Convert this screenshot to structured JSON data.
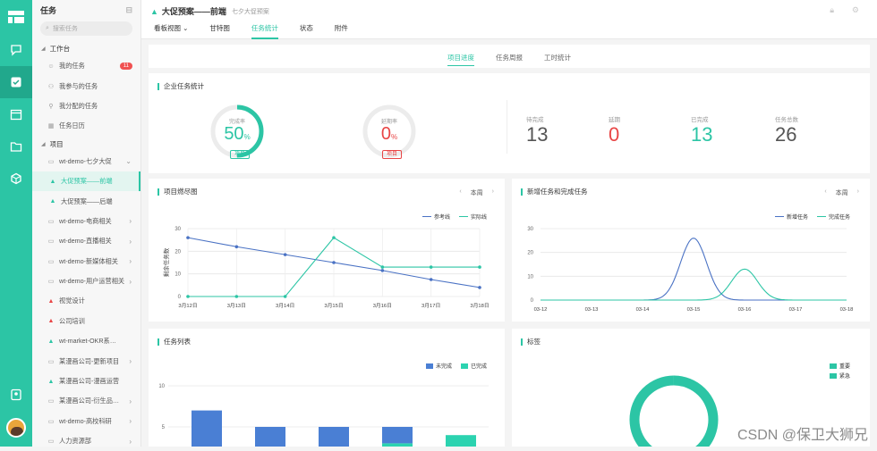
{
  "sidebar": {
    "title": "任务",
    "search_placeholder": "搜索任务",
    "workspace_label": "工作台",
    "workspace_items": [
      {
        "label": "我的任务",
        "badge": "11",
        "icon": "user-icon"
      },
      {
        "label": "我参与的任务",
        "badge": "",
        "icon": "group-icon"
      },
      {
        "label": "我分配的任务",
        "badge": "",
        "icon": "assign-icon"
      },
      {
        "label": "任务日历",
        "badge": "",
        "icon": "calendar-icon"
      }
    ],
    "projects_label": "项目",
    "project_items": [
      {
        "label": "wt-demo-七夕大促",
        "kind": "folder",
        "arrow": "⌄",
        "active": false,
        "sub": false
      },
      {
        "label": "大促预案——前端",
        "kind": "project",
        "arrow": "",
        "active": true,
        "sub": true
      },
      {
        "label": "大促预案——后端",
        "kind": "project",
        "arrow": "",
        "active": false,
        "sub": true
      },
      {
        "label": "wt-demo-电商相关",
        "kind": "folder",
        "arrow": "›",
        "active": false,
        "sub": false
      },
      {
        "label": "wt-demo-直播相关",
        "kind": "folder",
        "arrow": "›",
        "active": false,
        "sub": false
      },
      {
        "label": "wt-demo-新媒体相关",
        "kind": "folder",
        "arrow": "›",
        "active": false,
        "sub": false
      },
      {
        "label": "wt-demo-用户运营相关",
        "kind": "folder",
        "arrow": "›",
        "active": false,
        "sub": false
      },
      {
        "label": "视觉设计",
        "kind": "project-red",
        "arrow": "",
        "active": false,
        "sub": false
      },
      {
        "label": "公司培训",
        "kind": "project-red",
        "arrow": "",
        "active": false,
        "sub": false
      },
      {
        "label": "wt-market-OKR系…",
        "kind": "project",
        "arrow": "",
        "active": false,
        "sub": false
      },
      {
        "label": "某漫画公司-更新项目",
        "kind": "folder",
        "arrow": "›",
        "active": false,
        "sub": false
      },
      {
        "label": "某漫画公司-漫画运营",
        "kind": "project",
        "arrow": "",
        "active": false,
        "sub": false
      },
      {
        "label": "某漫画公司-衍生品…",
        "kind": "folder",
        "arrow": "›",
        "active": false,
        "sub": false
      },
      {
        "label": "wt-demo-高校科研",
        "kind": "folder",
        "arrow": "›",
        "active": false,
        "sub": false
      },
      {
        "label": "人力资源部",
        "kind": "folder",
        "arrow": "›",
        "active": false,
        "sub": false
      }
    ]
  },
  "header": {
    "project_title": "大促预案——前端",
    "project_subtitle": "七夕大促预案",
    "tabs": [
      {
        "label": "看板视图 ⌄",
        "active": false
      },
      {
        "label": "甘特图",
        "active": false
      },
      {
        "label": "任务统计",
        "active": true
      },
      {
        "label": "状态",
        "active": false
      },
      {
        "label": "附件",
        "active": false
      }
    ]
  },
  "subtabs": [
    {
      "label": "项目进度",
      "active": true
    },
    {
      "label": "任务周报",
      "active": false
    },
    {
      "label": "工时统计",
      "active": false
    }
  ],
  "stats": {
    "title": "企业任务统计",
    "completion": {
      "label": "完成率",
      "value": "50",
      "unit": "%",
      "tag": "项目",
      "color": "#2cc5a5",
      "fraction": 0.5
    },
    "overdue": {
      "label": "延期率",
      "value": "0",
      "unit": "%",
      "tag": "项目",
      "color": "#e84545",
      "fraction": 0
    },
    "counters": [
      {
        "label": "待完成",
        "value": "13",
        "color": "#555555"
      },
      {
        "label": "延期",
        "value": "0",
        "color": "#e84545"
      },
      {
        "label": "已完成",
        "value": "13",
        "color": "#2cc5a5"
      },
      {
        "label": "任务总数",
        "value": "26",
        "color": "#555555"
      }
    ]
  },
  "burndown": {
    "title": "项目燃尽图",
    "period": "本周"
  },
  "newtasks": {
    "title": "新增任务和完成任务",
    "period": "本周"
  },
  "tasklist": {
    "title": "任务列表"
  },
  "tags": {
    "title": "标签"
  },
  "watermark": "CSDN @保卫大狮兄",
  "colors": {
    "accent": "#2cc5a5",
    "blue": "#4a72c4",
    "red": "#e84545"
  },
  "chart_data": [
    {
      "type": "line",
      "ylabel": "剩余任务数",
      "x": [
        "3月12日",
        "3月13日",
        "3月14日",
        "3月15日",
        "3月16日",
        "3月17日",
        "3月18日"
      ],
      "yticks": [
        0,
        10,
        20,
        30
      ],
      "ylim": [
        0,
        30
      ],
      "legend": "top-right",
      "series": [
        {
          "name": "参考线",
          "color": "#4a72c4",
          "values": [
            26,
            22,
            18.5,
            15,
            11.5,
            7.5,
            4
          ]
        },
        {
          "name": "实际线",
          "color": "#2cc5a5",
          "values": [
            0,
            0,
            0,
            26,
            13,
            13,
            13
          ]
        }
      ]
    },
    {
      "type": "line",
      "x": [
        "03-12",
        "03-13",
        "03-14",
        "03-15",
        "03-16",
        "03-17",
        "03-18"
      ],
      "yticks": [
        0,
        10,
        20,
        30
      ],
      "ylim": [
        0,
        30
      ],
      "legend": "top-right",
      "series": [
        {
          "name": "新增任务",
          "color": "#4a72c4",
          "values": [
            0,
            0,
            0,
            26,
            0,
            0,
            0
          ]
        },
        {
          "name": "完成任务",
          "color": "#2cc5a5",
          "values": [
            0,
            0,
            0,
            0,
            13,
            0,
            0
          ]
        }
      ]
    },
    {
      "type": "bar",
      "stacked": true,
      "yticks": [
        5,
        10
      ],
      "ylim": [
        0,
        10
      ],
      "legend": "top-right",
      "series": [
        {
          "name": "未完成",
          "color": "#4a7fd4",
          "values": [
            5,
            3,
            3,
            2,
            0
          ]
        },
        {
          "name": "已完成",
          "color": "#2cd3b0",
          "values": [
            2,
            2,
            2,
            3,
            4
          ]
        }
      ]
    },
    {
      "type": "pie",
      "donut": true,
      "legend": "top-right",
      "series": [
        {
          "name": "重要",
          "color": "#2cc5a5",
          "value": 1
        },
        {
          "name": "紧急",
          "color": "#2cc5a5",
          "value": 1
        }
      ]
    }
  ]
}
